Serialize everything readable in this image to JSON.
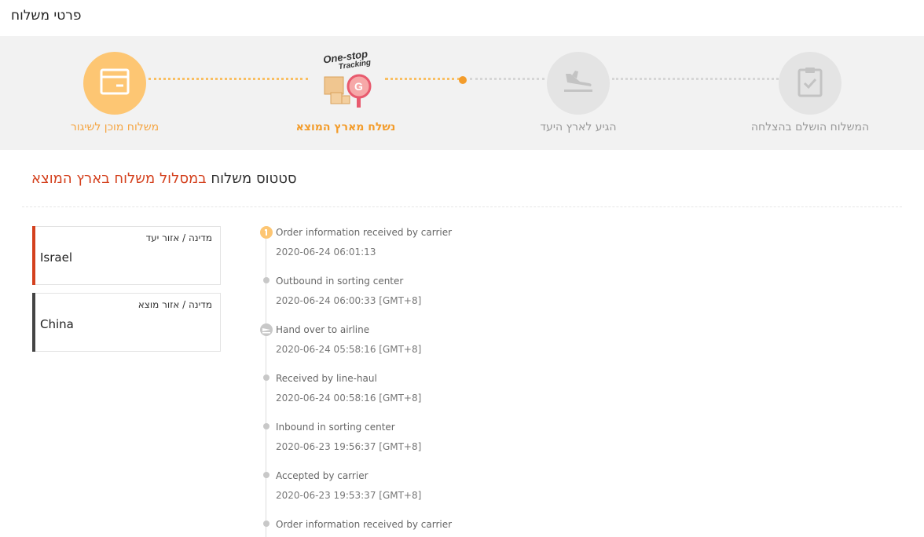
{
  "page_title": "פרטי משלוח",
  "steps": [
    {
      "label": "משלוח מוכן לשיגור",
      "icon": "package-icon"
    },
    {
      "label": "נשלח מארץ המוצא",
      "icon": "one-stop-tracking-icon",
      "logo_text_1": "One-stop",
      "logo_text_2": "Tracking"
    },
    {
      "label": "הגיע לארץ היעד",
      "icon": "airplane-landing-icon"
    },
    {
      "label": "המשלוח הושלם בהצלחה",
      "icon": "clipboard-check-icon"
    }
  ],
  "status": {
    "prefix": "סטטוס משלוח",
    "highlight": "במסלול משלוח בארץ המוצא"
  },
  "regions": [
    {
      "label": "מדינה / אזור יעד",
      "value": "Israel",
      "color": "#d4411e"
    },
    {
      "label": "מדינה / אזור מוצא",
      "value": "China",
      "color": "#444444"
    }
  ],
  "events": [
    {
      "title": "Order information received by carrier",
      "time": "2020-06-24 06:01:13",
      "icon": "info-icon"
    },
    {
      "title": "Outbound in sorting center",
      "time": "2020-06-24 06:00:33 [GMT+8]",
      "icon": "dot-icon"
    },
    {
      "title": "Hand over to airline",
      "time": "2020-06-24 05:58:16 [GMT+8]",
      "icon": "airplane-icon"
    },
    {
      "title": "Received by line-haul",
      "time": "2020-06-24 00:58:16 [GMT+8]",
      "icon": "dot-icon"
    },
    {
      "title": "Inbound in sorting center",
      "time": "2020-06-23 19:56:37 [GMT+8]",
      "icon": "dot-icon"
    },
    {
      "title": "Accepted by carrier",
      "time": "2020-06-23 19:53:37 [GMT+8]",
      "icon": "dot-icon"
    },
    {
      "title": "Order information received by carrier",
      "time": "",
      "icon": "dot-icon"
    }
  ],
  "colors": {
    "accent": "#f39c2b",
    "accent_light": "#fdc673",
    "highlight_red": "#d4411e",
    "inactive": "#e4e4e4"
  }
}
